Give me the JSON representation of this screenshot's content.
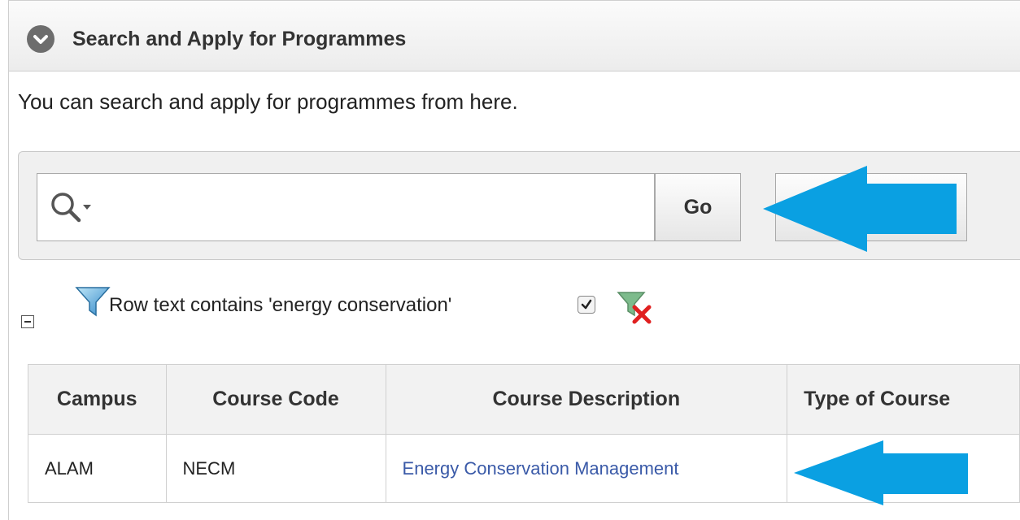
{
  "region": {
    "title": "Search and Apply for Programmes",
    "toggle_icon": "chevron-down-circle-icon"
  },
  "intro": {
    "text": "You can search and apply for programmes from here."
  },
  "search": {
    "value": "",
    "icon": "search-icon",
    "go_label": "Go"
  },
  "filter": {
    "text": "Row text contains 'energy conservation'",
    "enabled": true,
    "icon": "funnel-icon",
    "remove_icon": "remove-filter-icon"
  },
  "table": {
    "columns": [
      "Campus",
      "Course Code",
      "Course Description",
      "Type of Course"
    ],
    "rows": [
      {
        "campus": "ALAM",
        "code": "NECM",
        "description": "Energy Conservation Management",
        "type": ""
      }
    ]
  },
  "annotations": {
    "arrow_color": "#0aa0e2"
  },
  "colors": {
    "link": "#3a5aa8",
    "header_bg": "#f2f2f2",
    "border": "#d0d0d0"
  }
}
